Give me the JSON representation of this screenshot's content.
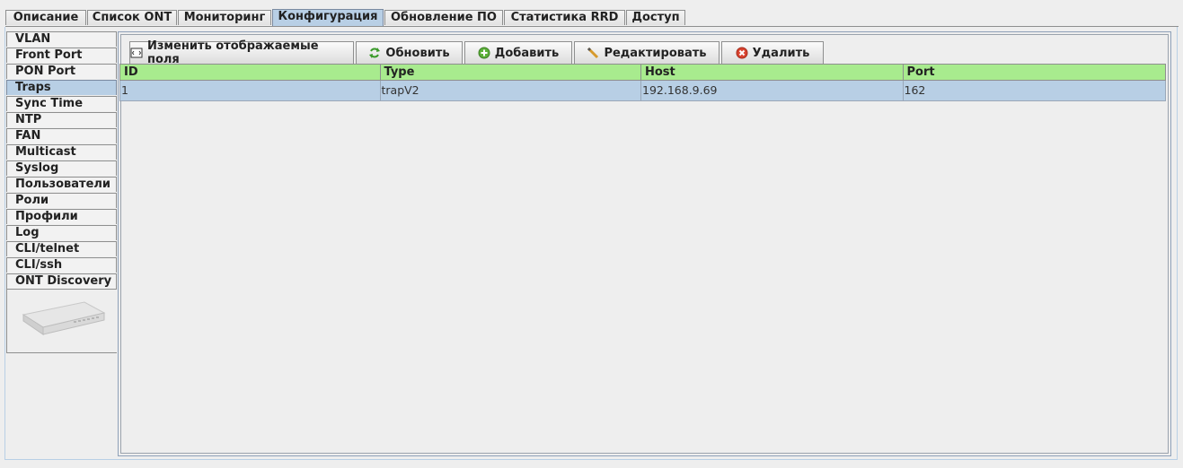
{
  "tabs": [
    {
      "label": "Описание"
    },
    {
      "label": "Список ONT"
    },
    {
      "label": "Мониторинг"
    },
    {
      "label": "Конфигурация"
    },
    {
      "label": "Обновление ПО"
    },
    {
      "label": "Статистика RRD"
    },
    {
      "label": "Доступ"
    }
  ],
  "active_tab": "Конфигурация",
  "sidebar": {
    "items": [
      {
        "label": "VLAN"
      },
      {
        "label": "Front Port"
      },
      {
        "label": "PON Port"
      },
      {
        "label": "Traps"
      },
      {
        "label": "Sync Time"
      },
      {
        "label": "NTP"
      },
      {
        "label": "FAN"
      },
      {
        "label": "Multicast"
      },
      {
        "label": "Syslog"
      },
      {
        "label": "Пользователи"
      },
      {
        "label": "Роли"
      },
      {
        "label": "Профили"
      },
      {
        "label": "Log"
      },
      {
        "label": "CLI/telnet"
      },
      {
        "label": "CLI/ssh"
      },
      {
        "label": "ONT Discovery"
      }
    ],
    "active": "Traps",
    "device_image_icon": "olt-device-icon"
  },
  "toolbar": {
    "change_fields_label": "Изменить отображаемые поля",
    "refresh_label": "Обновить",
    "add_label": "Добавить",
    "edit_label": "Редактировать",
    "delete_label": "Удалить"
  },
  "table": {
    "columns": [
      "ID",
      "Type",
      "Host",
      "Port"
    ],
    "rows": [
      {
        "id": "1",
        "type": "trapV2",
        "host": "192.168.9.69",
        "port": "162"
      }
    ]
  },
  "colors": {
    "selected": "#b8cfe5",
    "header_green": "#a8eb8e",
    "background": "#eeeeee"
  }
}
